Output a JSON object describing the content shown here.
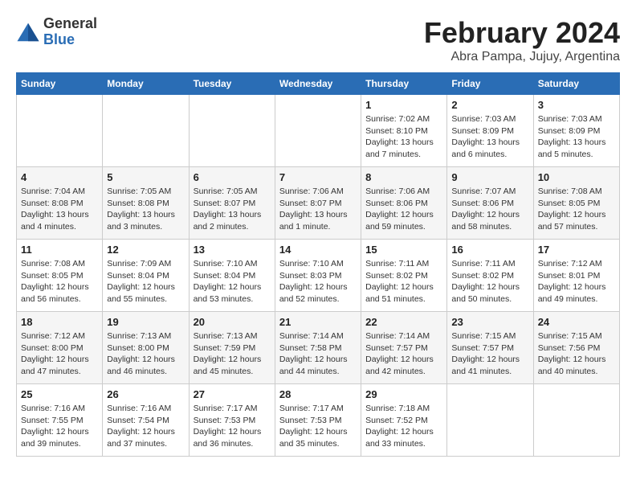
{
  "header": {
    "logo_general": "General",
    "logo_blue": "Blue",
    "month_title": "February 2024",
    "subtitle": "Abra Pampa, Jujuy, Argentina"
  },
  "weekdays": [
    "Sunday",
    "Monday",
    "Tuesday",
    "Wednesday",
    "Thursday",
    "Friday",
    "Saturday"
  ],
  "weeks": [
    [
      {
        "day": "",
        "info": ""
      },
      {
        "day": "",
        "info": ""
      },
      {
        "day": "",
        "info": ""
      },
      {
        "day": "",
        "info": ""
      },
      {
        "day": "1",
        "info": "Sunrise: 7:02 AM\nSunset: 8:10 PM\nDaylight: 13 hours and 7 minutes."
      },
      {
        "day": "2",
        "info": "Sunrise: 7:03 AM\nSunset: 8:09 PM\nDaylight: 13 hours and 6 minutes."
      },
      {
        "day": "3",
        "info": "Sunrise: 7:03 AM\nSunset: 8:09 PM\nDaylight: 13 hours and 5 minutes."
      }
    ],
    [
      {
        "day": "4",
        "info": "Sunrise: 7:04 AM\nSunset: 8:08 PM\nDaylight: 13 hours and 4 minutes."
      },
      {
        "day": "5",
        "info": "Sunrise: 7:05 AM\nSunset: 8:08 PM\nDaylight: 13 hours and 3 minutes."
      },
      {
        "day": "6",
        "info": "Sunrise: 7:05 AM\nSunset: 8:07 PM\nDaylight: 13 hours and 2 minutes."
      },
      {
        "day": "7",
        "info": "Sunrise: 7:06 AM\nSunset: 8:07 PM\nDaylight: 13 hours and 1 minute."
      },
      {
        "day": "8",
        "info": "Sunrise: 7:06 AM\nSunset: 8:06 PM\nDaylight: 12 hours and 59 minutes."
      },
      {
        "day": "9",
        "info": "Sunrise: 7:07 AM\nSunset: 8:06 PM\nDaylight: 12 hours and 58 minutes."
      },
      {
        "day": "10",
        "info": "Sunrise: 7:08 AM\nSunset: 8:05 PM\nDaylight: 12 hours and 57 minutes."
      }
    ],
    [
      {
        "day": "11",
        "info": "Sunrise: 7:08 AM\nSunset: 8:05 PM\nDaylight: 12 hours and 56 minutes."
      },
      {
        "day": "12",
        "info": "Sunrise: 7:09 AM\nSunset: 8:04 PM\nDaylight: 12 hours and 55 minutes."
      },
      {
        "day": "13",
        "info": "Sunrise: 7:10 AM\nSunset: 8:04 PM\nDaylight: 12 hours and 53 minutes."
      },
      {
        "day": "14",
        "info": "Sunrise: 7:10 AM\nSunset: 8:03 PM\nDaylight: 12 hours and 52 minutes."
      },
      {
        "day": "15",
        "info": "Sunrise: 7:11 AM\nSunset: 8:02 PM\nDaylight: 12 hours and 51 minutes."
      },
      {
        "day": "16",
        "info": "Sunrise: 7:11 AM\nSunset: 8:02 PM\nDaylight: 12 hours and 50 minutes."
      },
      {
        "day": "17",
        "info": "Sunrise: 7:12 AM\nSunset: 8:01 PM\nDaylight: 12 hours and 49 minutes."
      }
    ],
    [
      {
        "day": "18",
        "info": "Sunrise: 7:12 AM\nSunset: 8:00 PM\nDaylight: 12 hours and 47 minutes."
      },
      {
        "day": "19",
        "info": "Sunrise: 7:13 AM\nSunset: 8:00 PM\nDaylight: 12 hours and 46 minutes."
      },
      {
        "day": "20",
        "info": "Sunrise: 7:13 AM\nSunset: 7:59 PM\nDaylight: 12 hours and 45 minutes."
      },
      {
        "day": "21",
        "info": "Sunrise: 7:14 AM\nSunset: 7:58 PM\nDaylight: 12 hours and 44 minutes."
      },
      {
        "day": "22",
        "info": "Sunrise: 7:14 AM\nSunset: 7:57 PM\nDaylight: 12 hours and 42 minutes."
      },
      {
        "day": "23",
        "info": "Sunrise: 7:15 AM\nSunset: 7:57 PM\nDaylight: 12 hours and 41 minutes."
      },
      {
        "day": "24",
        "info": "Sunrise: 7:15 AM\nSunset: 7:56 PM\nDaylight: 12 hours and 40 minutes."
      }
    ],
    [
      {
        "day": "25",
        "info": "Sunrise: 7:16 AM\nSunset: 7:55 PM\nDaylight: 12 hours and 39 minutes."
      },
      {
        "day": "26",
        "info": "Sunrise: 7:16 AM\nSunset: 7:54 PM\nDaylight: 12 hours and 37 minutes."
      },
      {
        "day": "27",
        "info": "Sunrise: 7:17 AM\nSunset: 7:53 PM\nDaylight: 12 hours and 36 minutes."
      },
      {
        "day": "28",
        "info": "Sunrise: 7:17 AM\nSunset: 7:53 PM\nDaylight: 12 hours and 35 minutes."
      },
      {
        "day": "29",
        "info": "Sunrise: 7:18 AM\nSunset: 7:52 PM\nDaylight: 12 hours and 33 minutes."
      },
      {
        "day": "",
        "info": ""
      },
      {
        "day": "",
        "info": ""
      }
    ]
  ]
}
